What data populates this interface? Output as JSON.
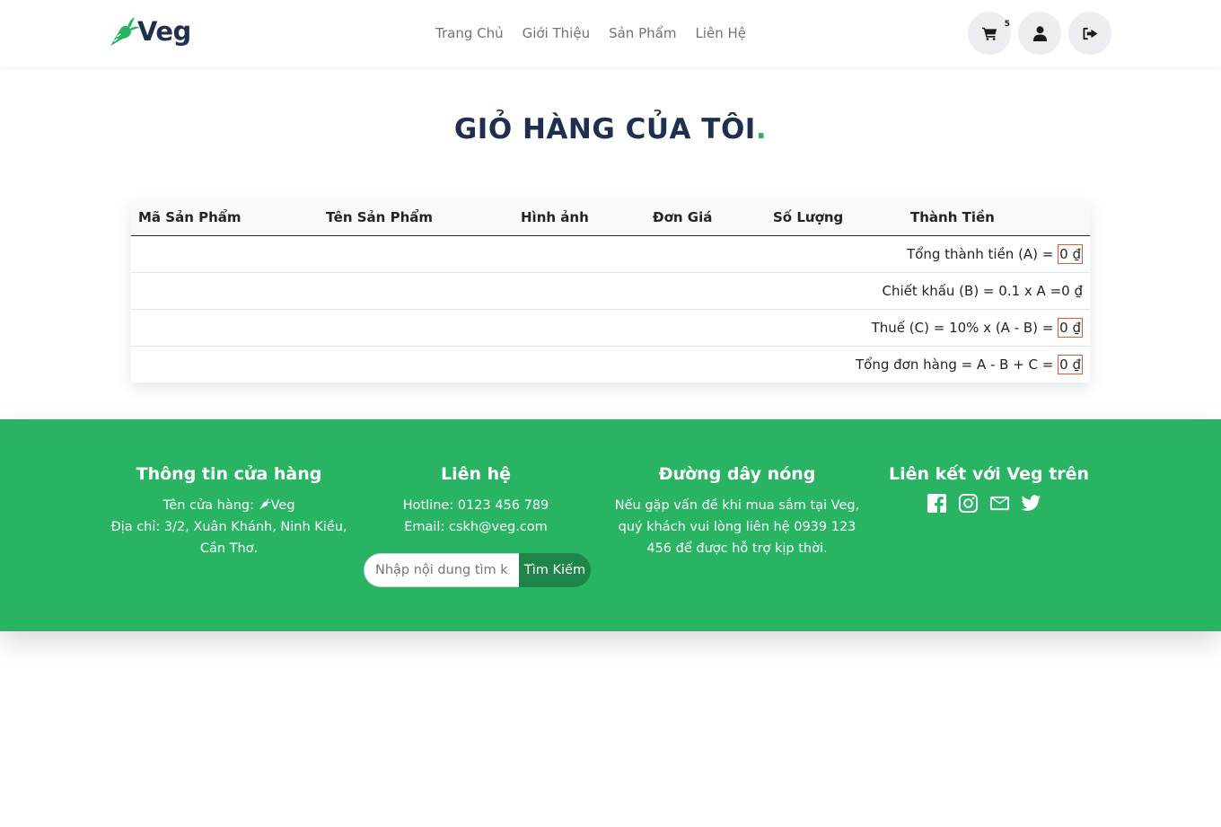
{
  "brand": {
    "name": "Veg",
    "accent": "#28b463",
    "dark": "#1f2f4f"
  },
  "nav": {
    "items": [
      {
        "label": "Trang Chủ"
      },
      {
        "label": "Giới Thiệu"
      },
      {
        "label": "Sản Phẩm"
      },
      {
        "label": "Liên Hệ"
      }
    ],
    "cart_count": "5",
    "icons": [
      "cart-icon",
      "user-icon",
      "sign-out-icon"
    ]
  },
  "page": {
    "title": "GIỎ HÀNG CỦA TÔI",
    "title_dot": "."
  },
  "cart": {
    "columns": [
      "Mã Sản Phẩm",
      "Tên Sản Phẩm",
      "Hình ảnh",
      "Đơn Giá",
      "Số Lượng",
      "Thành Tiền"
    ],
    "summary": [
      {
        "label": "Tổng thành tiền (A) = ",
        "value": "0 ₫",
        "boxed": true
      },
      {
        "label": "Chiết khấu (B) = 0.1 x A =",
        "value": "0 ₫",
        "boxed": false
      },
      {
        "label": "Thuế (C) = 10% x (A - B) = ",
        "value": "0 ₫",
        "boxed": true
      },
      {
        "label": "Tổng đơn hàng = A - B + C = ",
        "value": "0 ₫",
        "boxed": true
      }
    ]
  },
  "footer": {
    "bg": "#28b463",
    "store": {
      "title": "Thông tin cửa hàng",
      "name_prefix": "Tên cửa hàng: ",
      "name": "Veg",
      "address": "Địa chỉ: 3/2, Xuân Khánh, Ninh Kiều, Cần Thơ."
    },
    "contact": {
      "title": "Liên hệ",
      "hotline": "Hotline: 0123 456 789",
      "email": "Email: cskh@veg.com",
      "search_placeholder": "Nhập nội dung tìm kiếm",
      "search_button": "Tìm Kiếm"
    },
    "hotline": {
      "title": "Đường dây nóng",
      "text": "Nếu gặp vấn đề khi mua sắm tại Veg, quý khách vui lòng liên hệ 0939 123 456 để được hỗ trợ kịp thời."
    },
    "social": {
      "title": "Liên kết với Veg trên",
      "icons": [
        "facebook-icon",
        "instagram-icon",
        "envelope-icon",
        "twitter-icon"
      ]
    }
  }
}
